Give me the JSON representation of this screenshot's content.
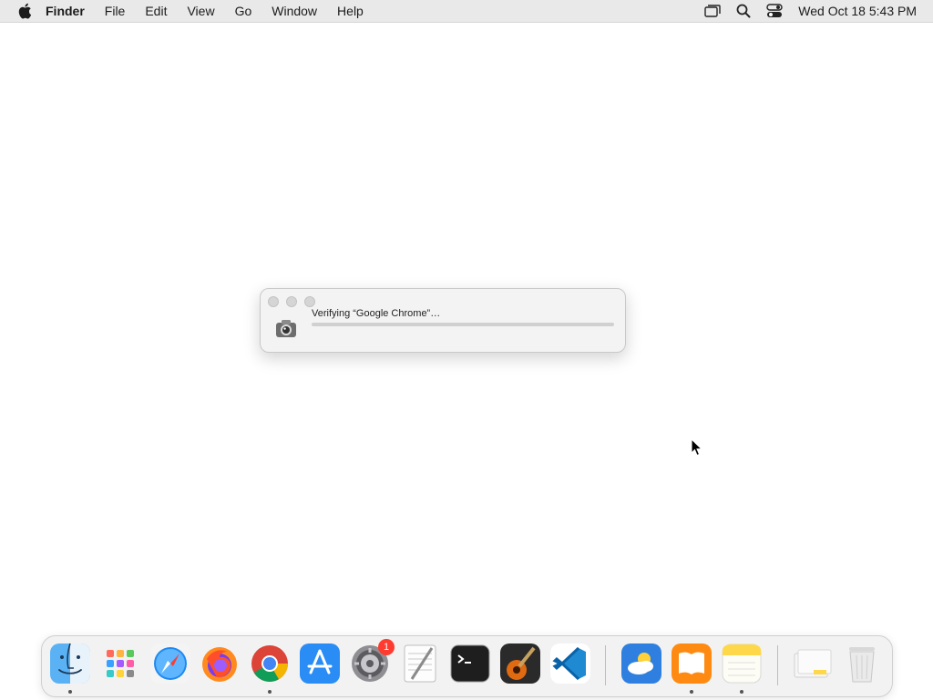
{
  "menubar": {
    "app_name": "Finder",
    "items": [
      "File",
      "Edit",
      "View",
      "Go",
      "Window",
      "Help"
    ],
    "clock": "Wed Oct 18  5:43 PM"
  },
  "dialog": {
    "message": "Verifying “Google Chrome”…",
    "progress": 0.0
  },
  "dock": {
    "settings_badge": "1",
    "apps": [
      "Finder",
      "Launchpad",
      "Safari",
      "Firefox",
      "Google Chrome",
      "App Store",
      "System Settings",
      "TextEdit",
      "Terminal",
      "GarageBand",
      "Visual Studio Code",
      "Weather",
      "Books",
      "Notes",
      "Downloads",
      "Trash"
    ]
  }
}
